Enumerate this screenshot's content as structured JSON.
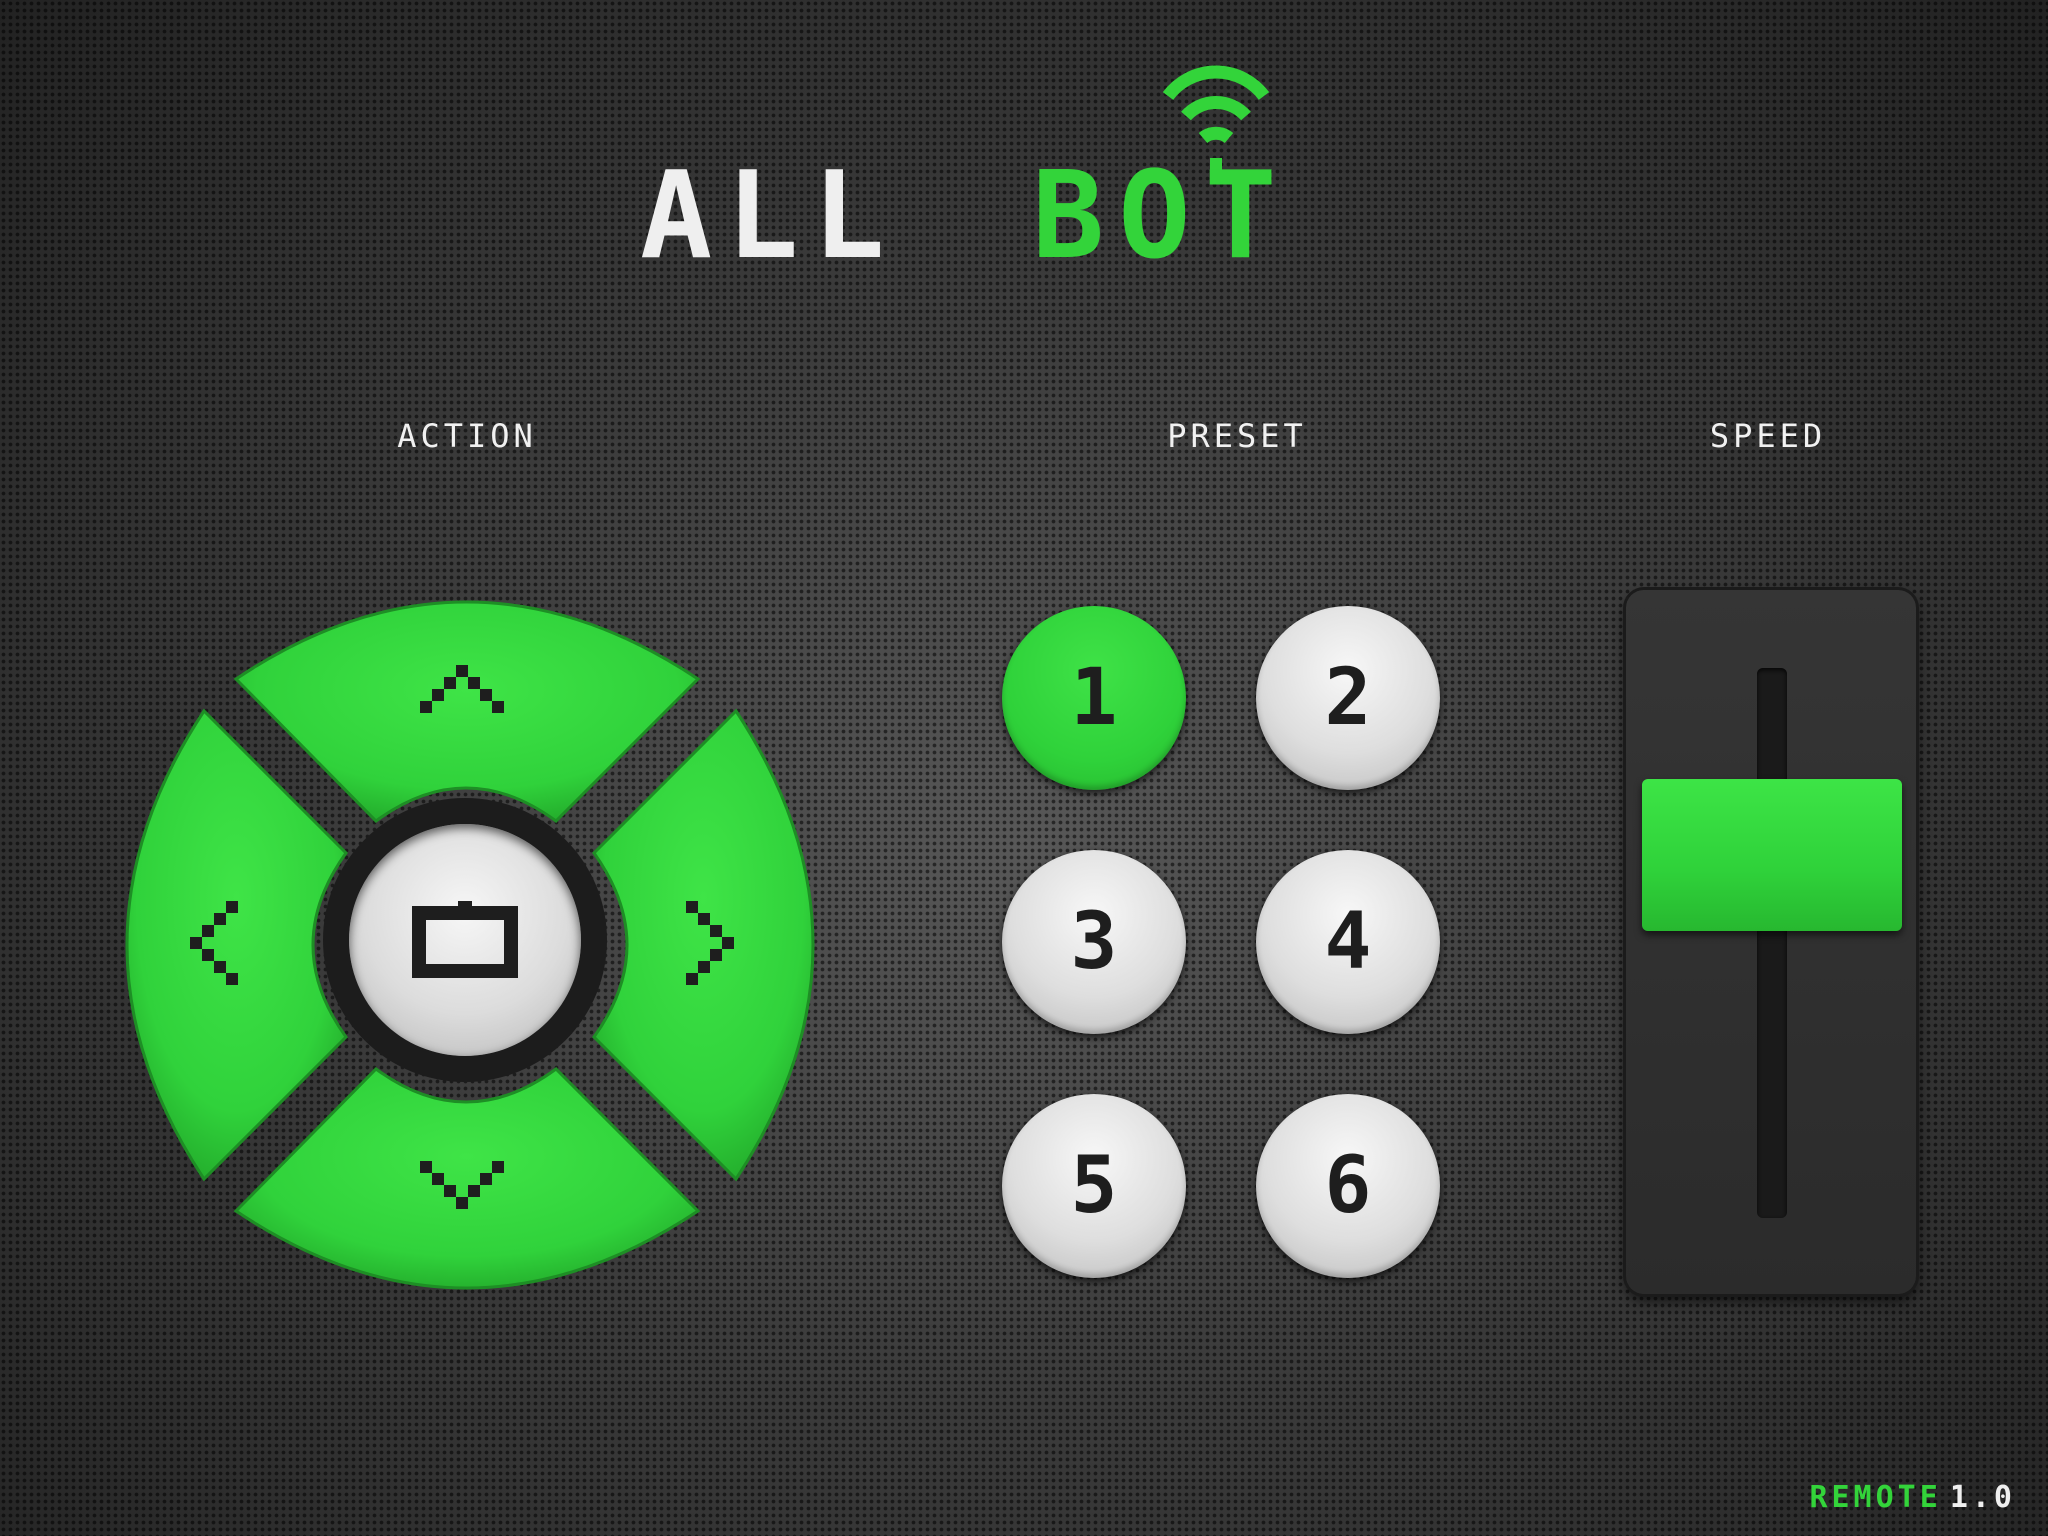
{
  "logo": {
    "part1": "ALL",
    "part2": "BOT",
    "icon": "wifi-robot-icon"
  },
  "colors": {
    "accent": "#33d43a",
    "button_light": "#dcdcdc",
    "background": "#3a3a3a",
    "text": "#f1f1f1"
  },
  "sections": {
    "action": "ACTION",
    "preset": "PRESET",
    "speed": "SPEED"
  },
  "dpad": {
    "up_icon": "chevron-up-icon",
    "down_icon": "chevron-down-icon",
    "left_icon": "chevron-left-icon",
    "right_icon": "chevron-right-icon",
    "center_icon": "stop-square-icon"
  },
  "presets": [
    {
      "label": "1",
      "active": true
    },
    {
      "label": "2",
      "active": false
    },
    {
      "label": "3",
      "active": false
    },
    {
      "label": "4",
      "active": false
    },
    {
      "label": "5",
      "active": false
    },
    {
      "label": "6",
      "active": false
    }
  ],
  "speed": {
    "level": 0.72
  },
  "footer": {
    "remote": "REMOTE",
    "version": "1.0"
  }
}
